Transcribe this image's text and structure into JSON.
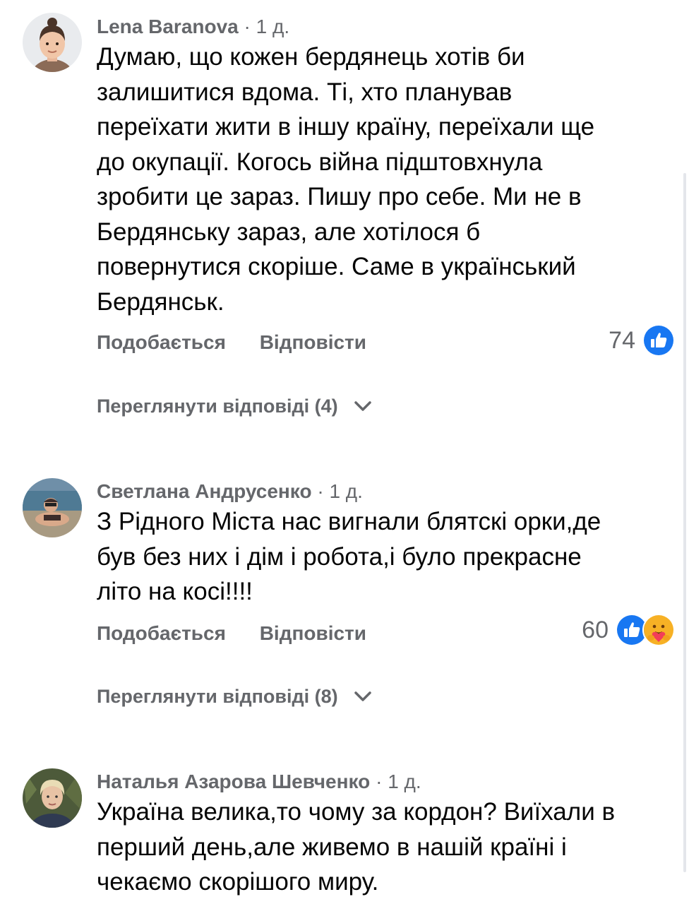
{
  "comments": [
    {
      "author": "Lena Baranova",
      "separator": "·",
      "time": "1 д.",
      "text": "Думаю, що кожен бердянець хотів би\nзалишитися вдома. Ті, хто планував\nпереїхати жити в іншу країну, переїхали ще\nдо окупації. Когось війна підштовхнула\nзробити це зараз. Пишу про себе. Ми не в\nБердянську зараз, але хотілося б\nповернутися скоріше. Саме в український\nБердянськ.",
      "like_label": "Подобається",
      "reply_label": "Відповісти",
      "reaction_count": "74",
      "reactions": [
        "like-icon"
      ],
      "view_replies": "Переглянути відповіді (4)"
    },
    {
      "author": "Светлана Андрусенко",
      "separator": "·",
      "time": "1 д.",
      "text": "З Рідного Міста нас вигнали блятскі орки,де\nбув без них і дім і робота,і було прекрасне\nліто на косі!!!!",
      "like_label": "Подобається",
      "reply_label": "Відповісти",
      "reaction_count": "60",
      "reactions": [
        "like-icon",
        "care-icon"
      ],
      "view_replies": "Переглянути відповіді (8)"
    },
    {
      "author": "Наталья Азарова Шевченко",
      "separator": "·",
      "time": "1 д.",
      "text": "Україна велика,то чому за кордон? Виїхали в\nперший день,але живемо в нашій країні і\nчекаємо скорішого миру."
    }
  ],
  "colors": {
    "secondary_text": "#65676b",
    "primary_text": "#050505",
    "like_blue": "#1877f2",
    "care_yellow": "#f7b125"
  }
}
